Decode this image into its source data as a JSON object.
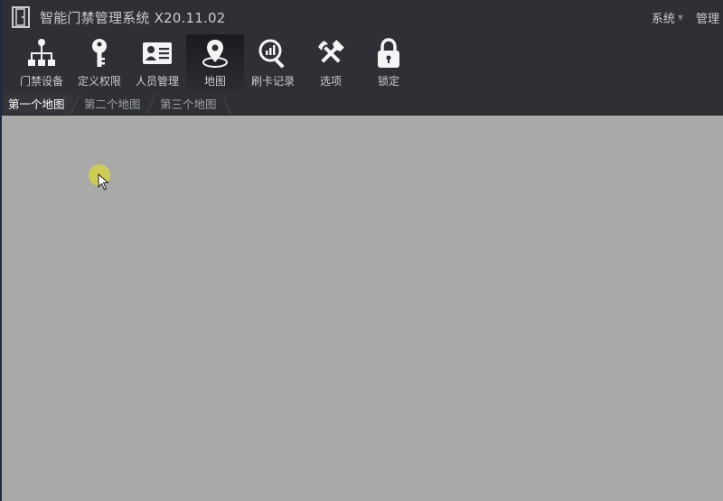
{
  "window": {
    "title": "智能门禁管理系统 X20.11.02",
    "logo_icon": "door-icon"
  },
  "title_menu": [
    {
      "label": "系统"
    },
    {
      "label": "管理"
    }
  ],
  "toolbar": {
    "items": [
      {
        "label": "门禁设备",
        "icon": "network-tree-icon"
      },
      {
        "label": "定义权限",
        "icon": "key-icon"
      },
      {
        "label": "人员管理",
        "icon": "id-card-icon"
      },
      {
        "label": "地图",
        "icon": "map-pin-icon",
        "active": true
      },
      {
        "label": "刷卡记录",
        "icon": "search-chart-icon"
      },
      {
        "label": "选项",
        "icon": "tools-icon"
      },
      {
        "label": "锁定",
        "icon": "lock-icon"
      }
    ]
  },
  "tabs": [
    {
      "label": "第一个地图",
      "active": true
    },
    {
      "label": "第二个地图"
    },
    {
      "label": "第三个地图"
    }
  ],
  "colors": {
    "background": "#2e3035",
    "canvas": "#a9aaa8",
    "text": "#c9ccd1",
    "icon": "#f2f4f6",
    "highlight": "#d6d246"
  }
}
